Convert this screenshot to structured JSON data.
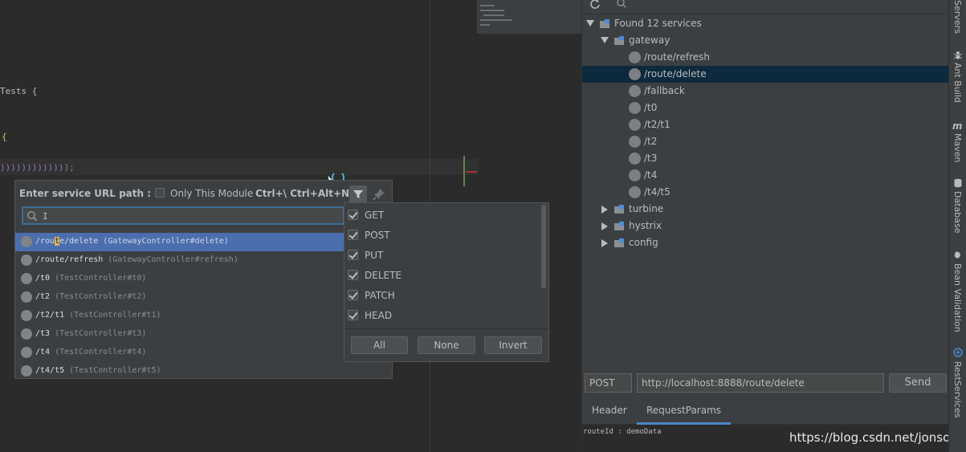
{
  "editor": {
    "line1": "Tests {",
    "line2": "{",
    "line3": ")))))))))))));"
  },
  "popup": {
    "title": "Enter service URL path :",
    "only_module_label": "Only This Module",
    "shortcut": "Ctrl+\\ Ctrl+Alt+N",
    "search_value": "I",
    "results": [
      {
        "path_pre": "/rou",
        "path_hl": "t",
        "path_post": "e/delete",
        "controller": "(GatewayController#delete)",
        "selected": true
      },
      {
        "path_pre": "/route/refresh",
        "path_hl": "",
        "path_post": "",
        "controller": "(GatewayController#refresh)",
        "selected": false
      },
      {
        "path_pre": "/t0",
        "path_hl": "",
        "path_post": "",
        "controller": "(TestController#t0)",
        "selected": false
      },
      {
        "path_pre": "/t2",
        "path_hl": "",
        "path_post": "",
        "controller": "(TestController#t2)",
        "selected": false
      },
      {
        "path_pre": "/t2/t1",
        "path_hl": "",
        "path_post": "",
        "controller": "(TestController#t1)",
        "selected": false
      },
      {
        "path_pre": "/t3",
        "path_hl": "",
        "path_post": "",
        "controller": "(TestController#t3)",
        "selected": false
      },
      {
        "path_pre": "/t4",
        "path_hl": "",
        "path_post": "",
        "controller": "(TestController#t4)",
        "selected": false
      },
      {
        "path_pre": "/t4/t5",
        "path_hl": "",
        "path_post": "",
        "controller": "(TestController#t5)",
        "selected": false
      }
    ]
  },
  "method_filter": {
    "methods": [
      "GET",
      "POST",
      "PUT",
      "DELETE",
      "PATCH",
      "HEAD"
    ],
    "all_label": "All",
    "none_label": "None",
    "invert_label": "Invert"
  },
  "rest_panel": {
    "tree": {
      "root": "Found 12 services",
      "gateway": "gateway",
      "gateway_items": [
        "/route/refresh",
        "/route/delete",
        "/fallback",
        "/t0",
        "/t2/t1",
        "/t2",
        "/t3",
        "/t4",
        "/t4/t5"
      ],
      "others": [
        "turbine",
        "hystrix",
        "config"
      ]
    },
    "method": "POST",
    "url": "http://localhost:8888/route/delete",
    "send_label": "Send",
    "tabs": [
      "Header",
      "RequestParams"
    ],
    "params_text": "routeId : demoData",
    "watermark": "https://blog.csdn.net/jonsonler"
  },
  "side_strip": [
    "Servers",
    "Ant Build",
    "Maven",
    "Database",
    "Bean Validation",
    "RestServices"
  ],
  "colors": {
    "selection": "#4b6eaf",
    "tree_selection": "#0d293e",
    "accent_tab": "#4a88c7"
  }
}
